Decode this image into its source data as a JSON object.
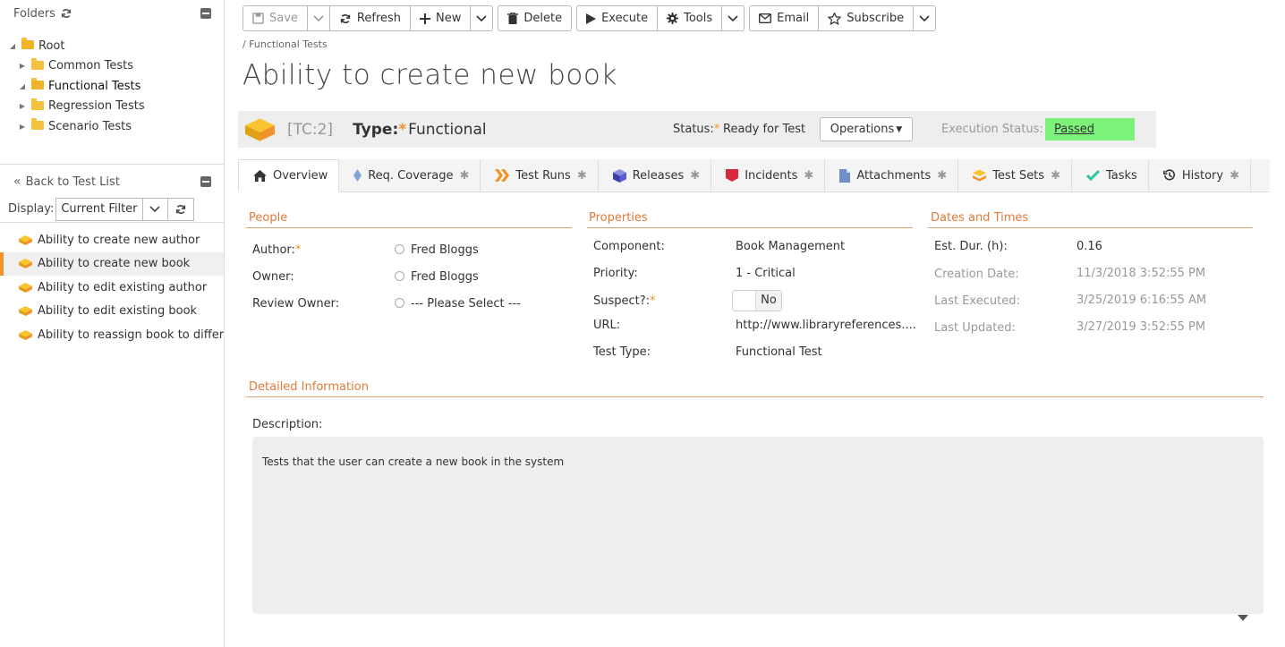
{
  "sidebar": {
    "folders_title": "Folders",
    "folders": [
      {
        "label": "Root",
        "level": 0
      },
      {
        "label": "Common Tests",
        "level": 1
      },
      {
        "label": "Functional Tests",
        "level": 1
      },
      {
        "label": "Regression Tests",
        "level": 1
      },
      {
        "label": "Scenario Tests",
        "level": 1
      }
    ],
    "back_label": "Back to Test List",
    "display_label": "Display:",
    "display_value": "Current Filter",
    "tests": [
      "Ability to create new author",
      "Ability to create new book",
      "Ability to edit existing author",
      "Ability to edit existing book",
      "Ability to reassign book to differ"
    ]
  },
  "toolbar": {
    "save": "Save",
    "refresh": "Refresh",
    "new": "New",
    "delete": "Delete",
    "execute": "Execute",
    "tools": "Tools",
    "email": "Email",
    "subscribe": "Subscribe"
  },
  "breadcrumb": "/ Functional Tests",
  "title": "Ability to create new book",
  "header": {
    "id": "[TC:2]",
    "type_label": "Type:",
    "type_value": "Functional",
    "status_label": "Status:",
    "status_value": "Ready for Test",
    "operations": "Operations",
    "exec_label": "Execution Status:",
    "exec_value": "Passed",
    "exec_color": "#7df27a",
    "accent": "#f0932b"
  },
  "tabs": [
    {
      "label": "Overview",
      "icon": "home-icon"
    },
    {
      "label": "Req. Coverage",
      "icon": "diamond-icon"
    },
    {
      "label": "Test Runs",
      "icon": "chevrons-icon"
    },
    {
      "label": "Releases",
      "icon": "cube-icon"
    },
    {
      "label": "Incidents",
      "icon": "bug-icon"
    },
    {
      "label": "Attachments",
      "icon": "document-icon"
    },
    {
      "label": "Test Sets",
      "icon": "layers-icon"
    },
    {
      "label": "Tasks",
      "icon": "check-icon"
    },
    {
      "label": "History",
      "icon": "history-icon"
    }
  ],
  "people": {
    "heading": "People",
    "author_label": "Author:",
    "author_value": "Fred Bloggs",
    "owner_label": "Owner:",
    "owner_value": "Fred Bloggs",
    "review_label": "Review Owner:",
    "review_value": "--- Please Select ---"
  },
  "properties": {
    "heading": "Properties",
    "component_label": "Component:",
    "component_value": "Book Management",
    "priority_label": "Priority:",
    "priority_value": "1 - Critical",
    "suspect_label": "Suspect?:",
    "suspect_value": "No",
    "url_label": "URL:",
    "url_value": "http://www.libraryreferences....",
    "testtype_label": "Test Type:",
    "testtype_value": "Functional Test"
  },
  "dates": {
    "heading": "Dates and Times",
    "estdur_label": "Est. Dur. (h):",
    "estdur_value": "0.16",
    "created_label": "Creation Date:",
    "created_value": "11/3/2018 3:52:55 PM",
    "executed_label": "Last Executed:",
    "executed_value": "3/25/2019 6:16:55 AM",
    "updated_label": "Last Updated:",
    "updated_value": "3/27/2019 3:52:55 PM"
  },
  "detail": {
    "heading": "Detailed Information",
    "desc_label": "Description:",
    "desc_value": "Tests that the user can create a new book in the system"
  }
}
